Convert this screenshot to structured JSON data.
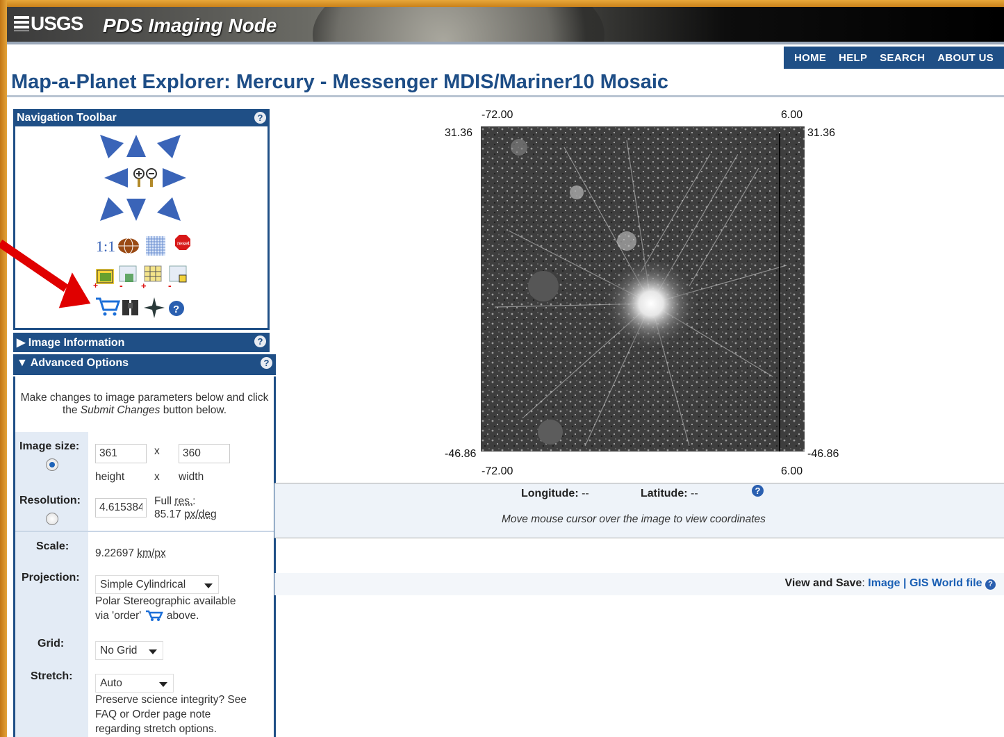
{
  "banner": {
    "logo": "USGS",
    "title": "PDS Imaging Node"
  },
  "topnav": [
    "HOME",
    "HELP",
    "SEARCH",
    "ABOUT US"
  ],
  "page_title": "Map-a-Planet Explorer: Mercury - Messenger MDIS/Mariner10 Mosaic",
  "nav_toolbar": {
    "title": "Navigation Toolbar",
    "help": "?",
    "scale_label": "1:1",
    "reset_label": "reset",
    "icons": [
      "pan-northwest-icon",
      "pan-north-icon",
      "pan-northeast-icon",
      "pan-west-icon",
      "zoom-in-icon",
      "zoom-out-icon",
      "pan-east-icon",
      "pan-southwest-icon",
      "pan-south-icon",
      "pan-southeast-icon",
      "globe-icon",
      "grid-icon",
      "reset-icon",
      "expand-grid-icon",
      "shrink-grid-icon",
      "grid-plus-icon",
      "grid-minus-icon",
      "cart-icon",
      "binoculars-icon",
      "compass-icon",
      "help-icon"
    ]
  },
  "image_info": {
    "title": "Image Information",
    "help": "?"
  },
  "advanced": {
    "title": "Advanced Options",
    "help": "?",
    "intro_1": "Make changes to image parameters below and click the ",
    "intro_em": "Submit Changes",
    "intro_2": " button below.",
    "image_size_label": "Image size:",
    "height_value": "361",
    "width_value": "360",
    "times": "x",
    "height_label": "height",
    "width_label": "width",
    "resolution_label": "Resolution:",
    "resolution_value": "4.615384",
    "full_res_prefix": "Full ",
    "full_res_link": "res.",
    "full_res_colon": ":",
    "full_res_value": "85.17",
    "full_res_unit": "px/deg",
    "scale_label": "Scale:",
    "scale_value": "9.22697",
    "scale_unit": "km/px",
    "projection_label": "Projection:",
    "projection_value": "Simple Cylindrical",
    "projection_note_1": "Polar Stereographic available",
    "projection_note_2a": "via 'order'",
    "projection_note_2b": "above.",
    "grid_label": "Grid:",
    "grid_value": "No Grid",
    "stretch_label": "Stretch:",
    "stretch_value": "Auto",
    "stretch_note_1": "Preserve science integrity? See",
    "stretch_note_2": "FAQ or Order page note",
    "stretch_note_3": "regarding stretch options."
  },
  "map": {
    "top_left_lon": "-72.00",
    "top_right_lon": "6.00",
    "bottom_left_lon": "-72.00",
    "bottom_right_lon": "6.00",
    "left_top_lat": "31.36",
    "right_top_lat": "31.36",
    "left_bottom_lat": "-46.86",
    "right_bottom_lat": "-46.86"
  },
  "coords": {
    "longitude_label": "Longitude:",
    "longitude_value": "--",
    "latitude_label": "Latitude:",
    "latitude_value": "--",
    "help": "?",
    "hint": "Move mouse cursor over the image to view coordinates"
  },
  "view_save": {
    "label": "View and Save",
    "colon": ":",
    "image_link": "Image",
    "sep": "|",
    "gis_link": "GIS World file",
    "help": "?"
  },
  "colors": {
    "accent": "#1f4f86",
    "frame": "#d9911f",
    "arrow": "#e00000",
    "link": "#1a5fb4"
  }
}
